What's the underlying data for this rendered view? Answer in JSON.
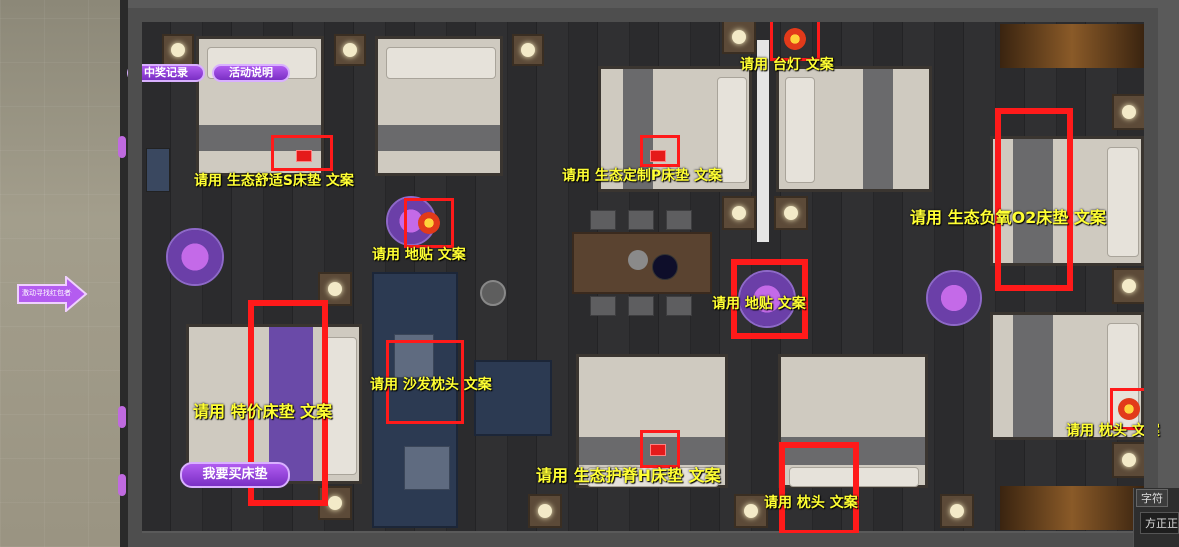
{
  "buttons": {
    "win_record": "中奖记录",
    "activity_desc": "活动说明",
    "buy_mattress": "我要买床垫",
    "enter_label": "激动寻找红包者~"
  },
  "annotations": {
    "mattress_s": "请用 生态舒适S床垫 文案",
    "mattress_p": "请用 生态定制P床垫 文案",
    "table_lamp": "请用 台灯 文案",
    "floor_sticker_1": "请用 地贴 文案",
    "floor_sticker_2": "请用 地贴 文案",
    "mattress_o2": "请用 生态负氧O2床垫 文案",
    "special_mattress": "请用 特价床垫 文案",
    "sofa_pillow": "请用 沙发枕头 文案",
    "mattress_h": "请用 生态护脊H床垫 文案",
    "pillow_1": "请用 枕头 文案",
    "pillow_2": "请用 枕头 文案"
  },
  "panel": {
    "tab": "字符",
    "font_value": "方正正"
  },
  "colors": {
    "highlight_box": "#ff1a1a",
    "annotation_text": "#ffff33",
    "button_purple": "#9b4de0"
  }
}
